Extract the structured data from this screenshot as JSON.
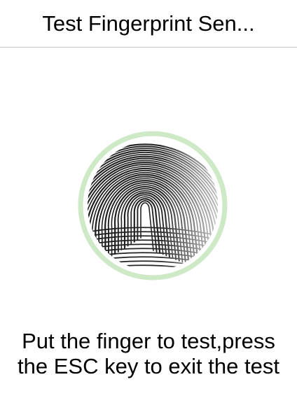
{
  "window": {
    "title": "Test Fingerprint Sen..."
  },
  "sensor": {
    "icon": "fingerprint-icon",
    "ring_color": "#cde9c6",
    "print_color": "#1a1a1a"
  },
  "instructions": {
    "line1": "Put the finger to test,press",
    "line2": "the ESC key to exit the test"
  }
}
